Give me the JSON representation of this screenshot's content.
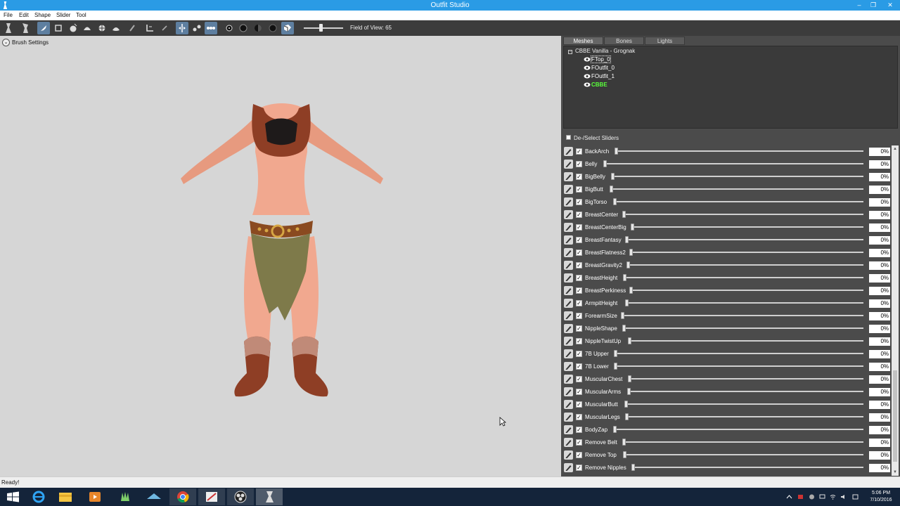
{
  "window": {
    "title": "Outfit Studio"
  },
  "menu": [
    "File",
    "Edit",
    "Shape",
    "Slider",
    "Tool"
  ],
  "toolbar": {
    "fov_label": "Field of View: 65"
  },
  "viewport": {
    "brush_settings": "Brush Settings"
  },
  "status": {
    "text": "Ready!"
  },
  "panel": {
    "tabs": [
      "Meshes",
      "Bones",
      "Lights"
    ],
    "active_tab": "Meshes",
    "project": "CBBE Vanilla - Grognak",
    "meshes": [
      {
        "name": "FTop_0",
        "selected": true
      },
      {
        "name": "FOutfit_0"
      },
      {
        "name": "FOutfit_1"
      },
      {
        "name": "CBBE",
        "reference": true
      }
    ],
    "deselect_label": "De-/Select Sliders",
    "sliders": [
      {
        "name": "BackArch",
        "value": "0%",
        "pos": 0
      },
      {
        "name": "Belly",
        "value": "0%",
        "pos": 0
      },
      {
        "name": "BigBelly",
        "value": "0%",
        "pos": 0
      },
      {
        "name": "BigButt",
        "value": "0%",
        "pos": 0
      },
      {
        "name": "BigTorso",
        "value": "0%",
        "pos": 0
      },
      {
        "name": "BreastCenter",
        "value": "0%",
        "pos": 0
      },
      {
        "name": "BreastCenterBig",
        "value": "0%",
        "pos": 0
      },
      {
        "name": "BreastFantasy",
        "value": "0%",
        "pos": 0
      },
      {
        "name": "BreastFlatness2",
        "value": "0%",
        "pos": 0
      },
      {
        "name": "BreastGravity2",
        "value": "0%",
        "pos": 0
      },
      {
        "name": "BreastHeight",
        "value": "0%",
        "pos": 0
      },
      {
        "name": "BreastPerkiness",
        "value": "0%",
        "pos": 0
      },
      {
        "name": "ArmpitHeight",
        "value": "0%",
        "pos": 0
      },
      {
        "name": "ForearmSize",
        "value": "0%",
        "pos": 0
      },
      {
        "name": "NippleShape",
        "value": "0%",
        "pos": 0
      },
      {
        "name": "NippleTwistUp",
        "value": "0%",
        "pos": 0
      },
      {
        "name": "7B Upper",
        "value": "0%",
        "pos": 0
      },
      {
        "name": "7B Lower",
        "value": "0%",
        "pos": 0
      },
      {
        "name": "MuscularChest",
        "value": "0%",
        "pos": 0
      },
      {
        "name": "MuscularArms",
        "value": "0%",
        "pos": 0
      },
      {
        "name": "MuscularButt",
        "value": "0%",
        "pos": 0
      },
      {
        "name": "MuscularLegs",
        "value": "0%",
        "pos": 0
      },
      {
        "name": "BodyZap",
        "value": "0%",
        "pos": 0
      },
      {
        "name": "Remove Belt",
        "value": "0%",
        "pos": 0
      },
      {
        "name": "Remove Top",
        "value": "0%",
        "pos": 0
      },
      {
        "name": "Remove Nipples",
        "value": "0%",
        "pos": 0
      }
    ]
  },
  "taskbar": {
    "time": "5:06 PM",
    "date": "7/10/2016"
  },
  "colors": {
    "titlebar": "#2a9be5",
    "panel": "#4b4b4b",
    "toolbar": "#3c3c3c",
    "reference_mesh": "#59ff3a"
  }
}
